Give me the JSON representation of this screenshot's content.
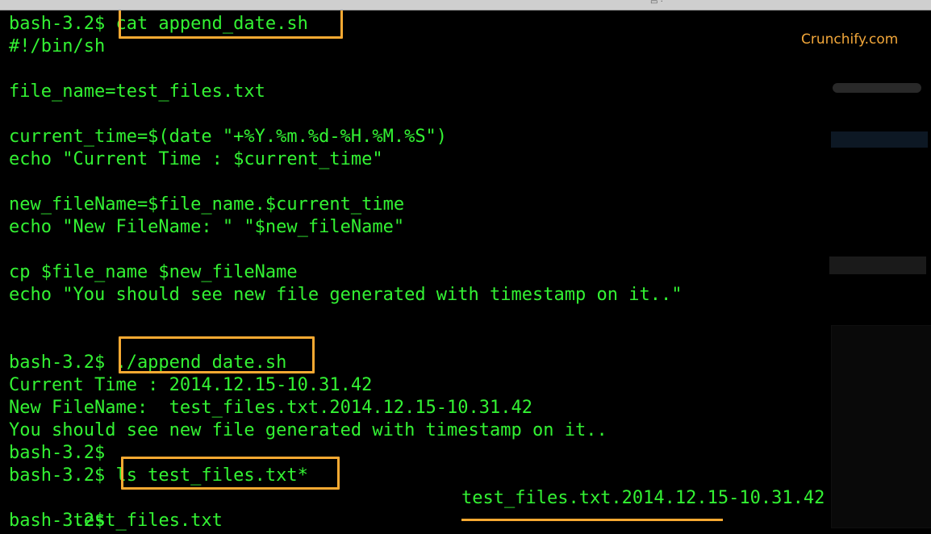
{
  "terminal": {
    "watermark": "Crunchify.com",
    "lines": [
      "bash-3.2$ cat append_date.sh",
      "#!/bin/sh",
      "",
      "file_name=test_files.txt",
      "",
      "current_time=$(date \"+%Y.%m.%d-%H.%M.%S\")",
      "echo \"Current Time : $current_time\"",
      "",
      "new_fileName=$file_name.$current_time",
      "echo \"New FileName: \" \"$new_fileName\"",
      "",
      "cp $file_name $new_fileName",
      "echo \"You should see new file generated with timestamp on it..\"",
      "",
      "",
      "bash-3.2$ ./append_date.sh",
      "Current Time : 2014.12.15-10.31.42",
      "New FileName:  test_files.txt.2014.12.15-10.31.42",
      "You should see new file generated with timestamp on it..",
      "bash-3.2$",
      "bash-3.2$ ls test_files.txt*",
      "bash-3.2$"
    ],
    "ls_output": {
      "file1": "test_files.txt",
      "file2": "test_files.txt.2014.12.15-10.31.42"
    },
    "colors": {
      "text": "#33f233",
      "highlight": "#f7a932",
      "background": "#000000"
    }
  }
}
